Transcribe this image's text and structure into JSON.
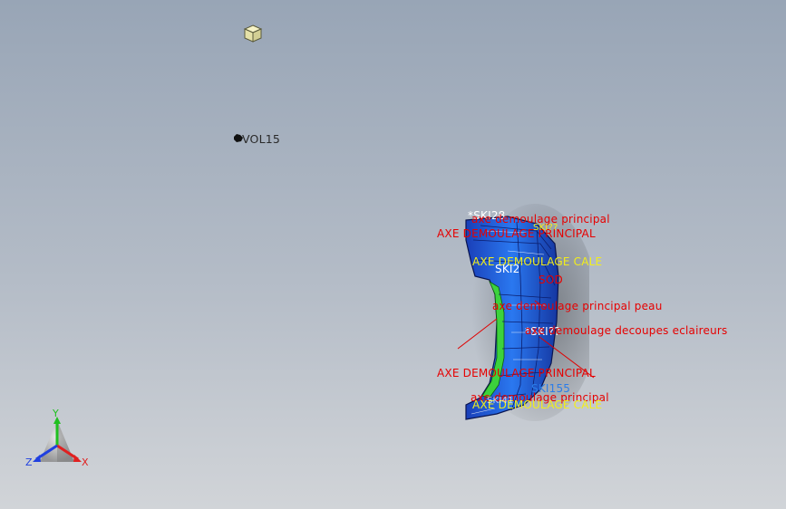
{
  "compass": {
    "x_label": "X",
    "y_label": "Y",
    "z_label": "Z"
  },
  "labels": {
    "vol15": "VOL15",
    "ski28": "*SKI28",
    "axe_demoulage_principal_lc_1": "axe demoulage principal",
    "axe_demoulage_principal_top": "AXE DEMOULAGE PRINCIPAL",
    "ski_top_right": "SKI??",
    "axe_demoulage_cale_top": "AXE DEMOULAGE CALE",
    "ski12": "SKI2",
    "sod": "SOD",
    "axe_demoulage_principal_peau": "axe demoulage principal peau",
    "ski_mid": "*SKI??",
    "axe_demoulage_decoupes": "axe demoulage decoupes eclaireurs",
    "axe_demoulage_principal_mid": "AXE DEMOULAGE PRINCIPAL",
    "ski155": "SKI155",
    "axe_demoulage_principal_lc_2": "axe demoulage principal",
    "axe_demoulage_cale_bottom": "AXE DEMOULAGE CALE",
    "ski_bottom": "SKI41"
  },
  "icons": {
    "nav_cube": "navigation-cube-icon",
    "volume": "volume-body-icon",
    "compass": "xyz-axis-compass-icon"
  },
  "colors": {
    "background_top": "#98a5b6",
    "background_bottom": "#d1d4d8",
    "annotation_red": "#e60000",
    "annotation_yellow": "#f2ee1a",
    "part_blue": "#1f5fe0",
    "part_green": "#3cd23c",
    "axis_x": "#e02020",
    "axis_y": "#20c020",
    "axis_z": "#2040e0"
  }
}
